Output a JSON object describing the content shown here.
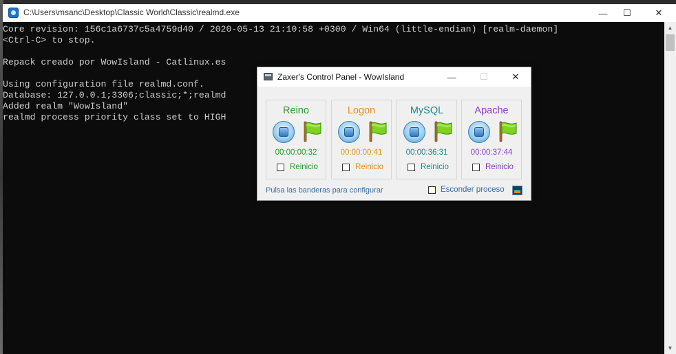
{
  "console": {
    "title": "C:\\Users\\msanc\\Desktop\\Classic World\\Classic\\realmd.exe",
    "lines": [
      "Core revision: 156c1a6737c5a4759d40 / 2020-05-13 21:10:58 +0300 / Win64 (little-endian) [realm-daemon]",
      "<Ctrl-C> to stop.",
      "",
      "Repack creado por WowIsland - Catlinux.es",
      "",
      "Using configuration file realmd.conf.",
      "Database: 127.0.0.1;3306;classic;*;realmd",
      "Added realm \"WowIsland\"",
      "realmd process priority class set to HIGH"
    ]
  },
  "window_controls": {
    "minimize": "—",
    "maximize": "☐",
    "close": "✕"
  },
  "panel": {
    "title": "Zaxer's Control Panel - WowIsland",
    "services": [
      {
        "name": "Reino",
        "time": "00:00:00:32",
        "restart_label": "Reinicio",
        "restart_checked": false,
        "color": "#2e9a2e"
      },
      {
        "name": "Logon",
        "time": "00:00:00:41",
        "restart_label": "Reinicio",
        "restart_checked": false,
        "color": "#e8901c"
      },
      {
        "name": "MySQL",
        "time": "00:00:36:31",
        "restart_label": "Reinicio",
        "restart_checked": false,
        "color": "#1f8a8a"
      },
      {
        "name": "Apache",
        "time": "00:00:37:44",
        "restart_label": "Reinicio",
        "restart_checked": false,
        "color": "#8a3fc1"
      }
    ],
    "hint": "Pulsa las banderas para configurar",
    "hide_process_label": "Esconder proceso",
    "hide_process_checked": false
  },
  "colors": {
    "console_bg": "#0c0c0c",
    "console_text": "#cccccc",
    "flag_green": "#7ed321"
  }
}
